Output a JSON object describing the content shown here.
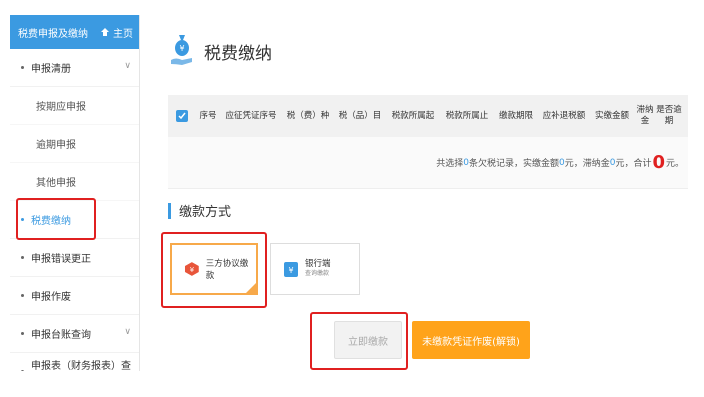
{
  "sidebar": {
    "header_title": "税费申报及缴纳",
    "home_label": "主页",
    "items": [
      {
        "label": "申报清册",
        "has_children": true
      },
      {
        "label": "按期应申报",
        "sub": true
      },
      {
        "label": "逾期申报",
        "sub": true
      },
      {
        "label": "其他申报",
        "sub": true
      },
      {
        "label": "税费缴纳",
        "active": true
      },
      {
        "label": "申报错误更正"
      },
      {
        "label": "申报作废"
      },
      {
        "label": "申报台账查询",
        "has_children": true
      },
      {
        "label": "申报表（财务报表）查询"
      }
    ]
  },
  "main": {
    "page_title": "税费缴纳",
    "table": {
      "columns": [
        "序号",
        "应征凭证序号",
        "税（费）种",
        "税（品）目",
        "税款所属起",
        "税款所属止",
        "缴款期限",
        "应补退税额",
        "实缴金额",
        "滞纳金",
        "是否逾期"
      ]
    },
    "summary": {
      "prefix": "共选择",
      "count": "0",
      "mid1": "条欠税记录，实缴金额",
      "paid": "0",
      "mid2": "元，滞纳金",
      "late": "0",
      "mid3": "元，合计",
      "total": "0",
      "suffix": "元。"
    },
    "payment_section_title": "缴款方式",
    "payment_methods": [
      {
        "label": "三方协议缴款",
        "selected": true
      },
      {
        "label": "银行端",
        "sub": "查询缴款",
        "selected": false
      }
    ],
    "buttons": {
      "pay_now": "立即缴款",
      "void_unpaid": "未缴款凭证作废(解锁)"
    }
  },
  "colors": {
    "accent": "#3b9ae1",
    "highlight": "#e02020",
    "orange": "#ffa31a"
  }
}
